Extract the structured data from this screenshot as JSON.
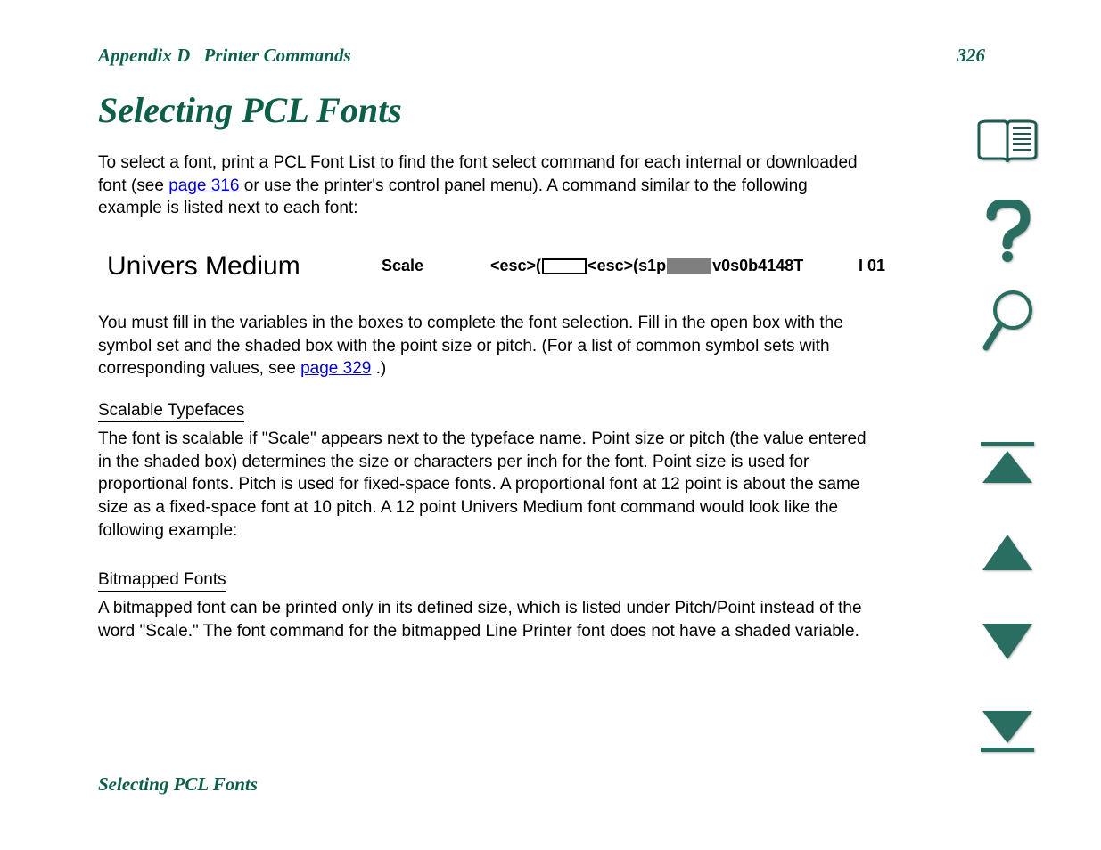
{
  "header": {
    "appendix": "Appendix D",
    "section": "Printer Commands",
    "page_number": "326"
  },
  "title": "Selecting PCL Fonts",
  "paragraph1": {
    "pre": "To select a font, print a PCL Font List to find the font select command for each internal or downloaded font (see ",
    "link": "page 316",
    "post": " or use the printer's control panel menu). A command similar to the following example is listed next to each font:"
  },
  "example": {
    "font_name": "Univers Medium",
    "scale": "Scale",
    "esc_pre": "<esc>(",
    "esc_mid": "<esc>(s1p",
    "esc_post": "v0s0b4148T",
    "id_label": "I  01"
  },
  "paragraph2": {
    "pre": "You must fill in the variables in the boxes to complete the font selection. Fill in the open box with the symbol set and the shaded box with the point size or pitch. (For a list of common symbol sets with corresponding values, see ",
    "link": "page 329",
    "post": ".)"
  },
  "subhead1": "Scalable Typefaces",
  "paragraph3": "The font is scalable if \"Scale\" appears next to the typeface name. Point size or pitch (the value entered in the shaded box) determines the size or characters per inch for the font. Point size is used for proportional fonts. Pitch is used for fixed-space fonts. A proportional font at 12 point is about the same size as a fixed-space font at 10 pitch. A 12 point Univers Medium font command would look like the following example:",
  "subhead2": "Bitmapped Fonts",
  "paragraph4": "A bitmapped font can be printed only in its defined size, which is listed under Pitch/Point instead of the word \"Scale.\" The font command for the bitmapped Line Printer font does not have a shaded variable.",
  "footer": "Selecting PCL Fonts",
  "nav": {
    "contents": "contents-icon",
    "help": "help-icon",
    "search": "search-icon",
    "first": "first-page-icon",
    "prev": "previous-page-icon",
    "next": "next-page-icon",
    "last": "last-page-icon"
  },
  "colors": {
    "teal": "#0d5f4a",
    "teal_fill": "#2a6e62"
  }
}
